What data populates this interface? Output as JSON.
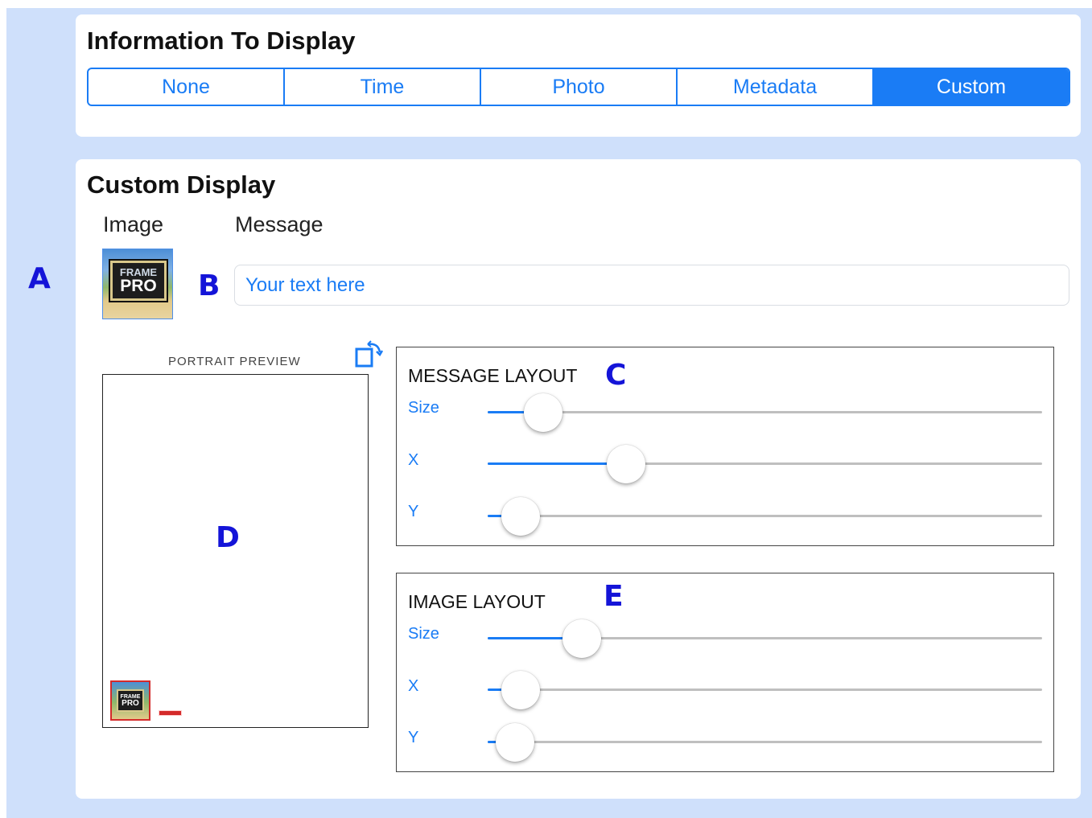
{
  "info_card": {
    "title": "Information To Display",
    "segments": [
      "None",
      "Time",
      "Photo",
      "Metadata",
      "Custom"
    ],
    "selected": "Custom"
  },
  "custom_card": {
    "title": "Custom Display",
    "image_label": "Image",
    "message_label": "Message",
    "message_placeholder": "Your text here",
    "logo_text_line1": "FRAME",
    "logo_text_line2": "PRO",
    "preview_caption": "PORTRAIT PREVIEW",
    "rotate_icon": "rotate-orientation-icon"
  },
  "message_layout": {
    "title": "MESSAGE LAYOUT",
    "sliders": [
      {
        "label": "Size",
        "value": 0.1
      },
      {
        "label": "X",
        "value": 0.25
      },
      {
        "label": "Y",
        "value": 0.06
      }
    ]
  },
  "image_layout": {
    "title": "IMAGE LAYOUT",
    "sliders": [
      {
        "label": "Size",
        "value": 0.17
      },
      {
        "label": "X",
        "value": 0.06
      },
      {
        "label": "Y",
        "value": 0.05
      }
    ]
  },
  "markers": {
    "a": "A",
    "b": "B",
    "c": "C",
    "d": "D",
    "e": "E"
  },
  "colors": {
    "accent": "#1a7cf5",
    "page_background": "#cfe0fb",
    "marker": "#1414d8",
    "preview_highlight": "#d42a2a"
  }
}
